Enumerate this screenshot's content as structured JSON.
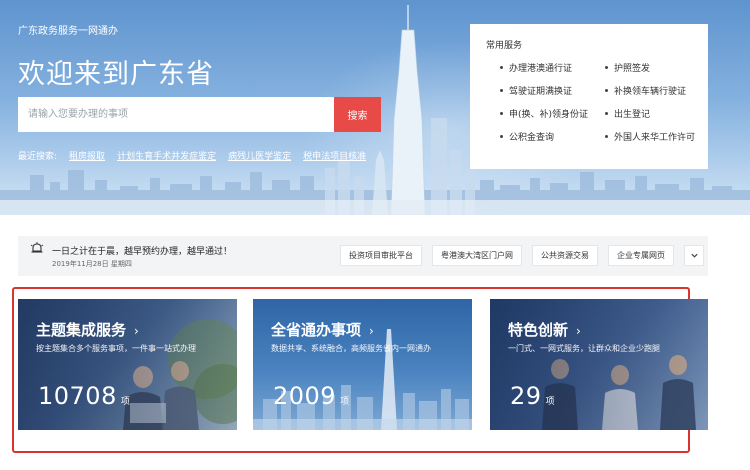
{
  "header": {
    "site_name": "广东政务服务一网通办",
    "welcome": "欢迎来到广东省",
    "search_placeholder": "请输入您要办理的事项",
    "search_button": "搜索",
    "recent_label": "最近搜索:",
    "recent_searches": [
      "租房报取",
      "计划生育手术并发症鉴定",
      "病残儿医学鉴定",
      "税申法项目核准"
    ]
  },
  "common_services": {
    "title": "常用服务",
    "items": [
      "办理港澳通行证",
      "护照签发",
      "驾驶证期满换证",
      "补换领车辆行驶证",
      "申(换、补)领身份证",
      "出生登记",
      "公积金查询",
      "外国人来华工作许可"
    ]
  },
  "notice": {
    "text": "一日之计在于晨，越早预约办理，越早通过！",
    "date": "2019年11月28日 星期四",
    "quick_links": [
      "投资项目审批平台",
      "粤港澳大湾区门户网",
      "公共资源交易",
      "企业专属网页"
    ],
    "more_icon": "chevron-down-icon"
  },
  "cards": [
    {
      "title": "主题集成服务",
      "desc": "按主题集合多个服务事项，一件事一站式办理",
      "count": "10708",
      "unit": "项"
    },
    {
      "title": "全省通办事项",
      "desc": "数据共享、系统融合，高频服务省内一网通办",
      "count": "2009",
      "unit": "项"
    },
    {
      "title": "特色创新",
      "desc": "一门式、一网式服务，让群众和企业少跑腿",
      "count": "29",
      "unit": "项"
    }
  ],
  "colors": {
    "accent_red": "#e84a48",
    "highlight_border": "#d9352f",
    "hero_sky": "#7aa8da"
  }
}
